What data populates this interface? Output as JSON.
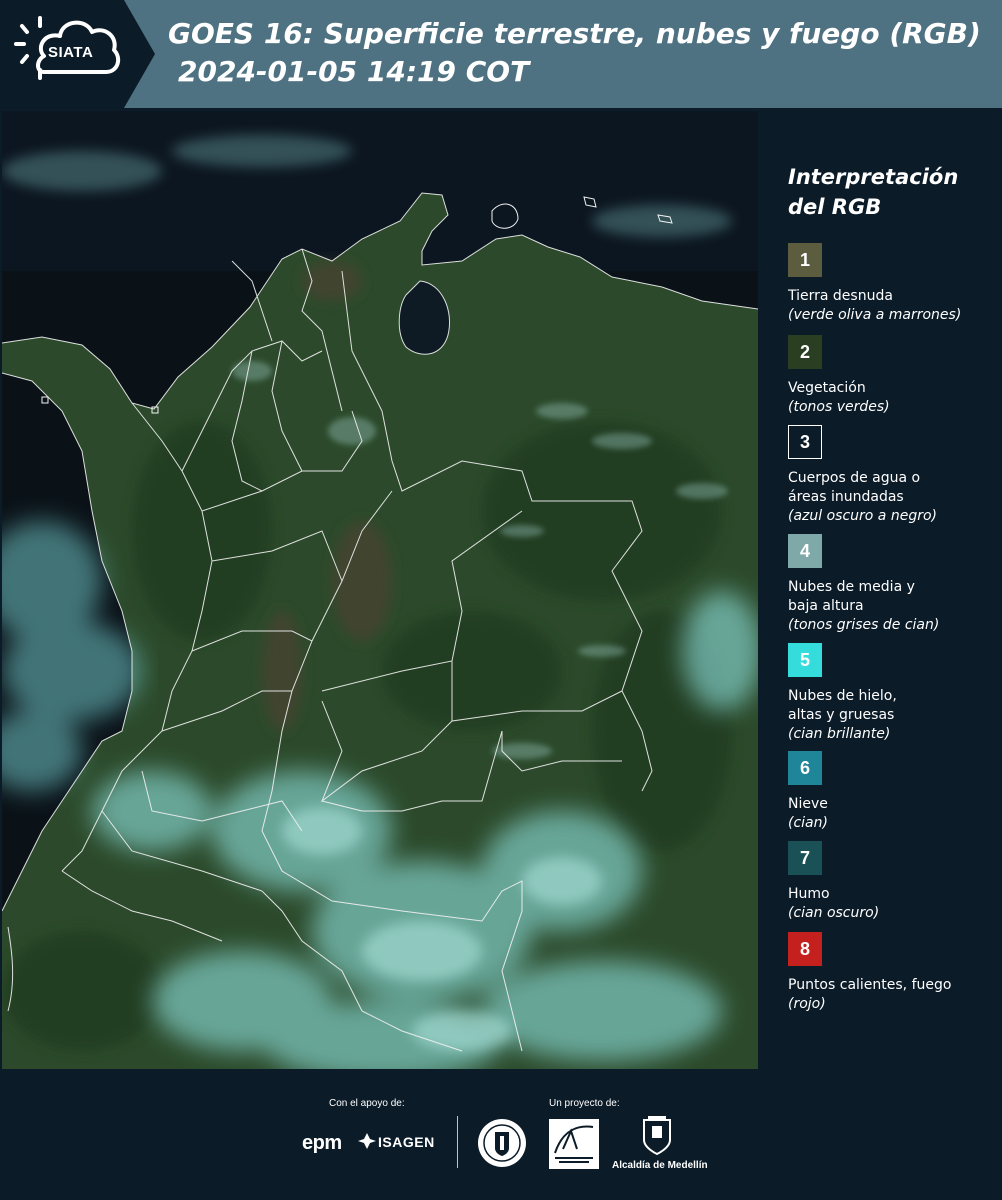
{
  "header": {
    "logo_text": "SIATA",
    "title": "GOES 16: Superficie terrestre, nubes y fuego (RGB)",
    "timestamp": "2024-01-05 14:19 COT"
  },
  "legend": {
    "title_line1": "Interpretación",
    "title_line2": "del RGB",
    "items": [
      {
        "number": "1",
        "label": "Tierra desnuda",
        "desc": "(verde oliva a marrones)",
        "color": "#5c5d3e"
      },
      {
        "number": "2",
        "label": "Vegetación",
        "desc": "(tonos verdes)",
        "color": "#2a3f22"
      },
      {
        "number": "3",
        "label": "Cuerpos de agua o áreas inundadas",
        "desc": "(azul oscuro a negro)",
        "color": "#0b1b28"
      },
      {
        "number": "4",
        "label": "Nubes de media y baja altura",
        "desc": "(tonos grises de cian)",
        "color": "#7ea9a8"
      },
      {
        "number": "5",
        "label": "Nubes de hielo, altas y gruesas",
        "desc": "(cian brillante)",
        "color": "#35dcdc"
      },
      {
        "number": "6",
        "label": "Nieve",
        "desc": "(cian)",
        "color": "#1f8699"
      },
      {
        "number": "7",
        "label": "Humo",
        "desc": "(cian oscuro)",
        "color": "#1a5156"
      },
      {
        "number": "8",
        "label": "Puntos calientes, fuego",
        "desc": "(rojo)",
        "color": "#c3201e"
      }
    ]
  },
  "footer": {
    "support_label": "Con el apoyo de:",
    "project_label": "Un proyecto de:",
    "sponsors": [
      "epm",
      "ISAGEN"
    ],
    "partners": [
      "Área Metropolitana Valle de Aburrá",
      "Alcaldía de Medellín"
    ],
    "medellin_label": "Alcaldía de Medellín"
  },
  "colors": {
    "header_bg": "#4e7282",
    "panel_bg": "#0b1b28",
    "vegetation": "#2f4a2c",
    "ocean": "#0a1218",
    "cloud": "#8fe3e0"
  }
}
